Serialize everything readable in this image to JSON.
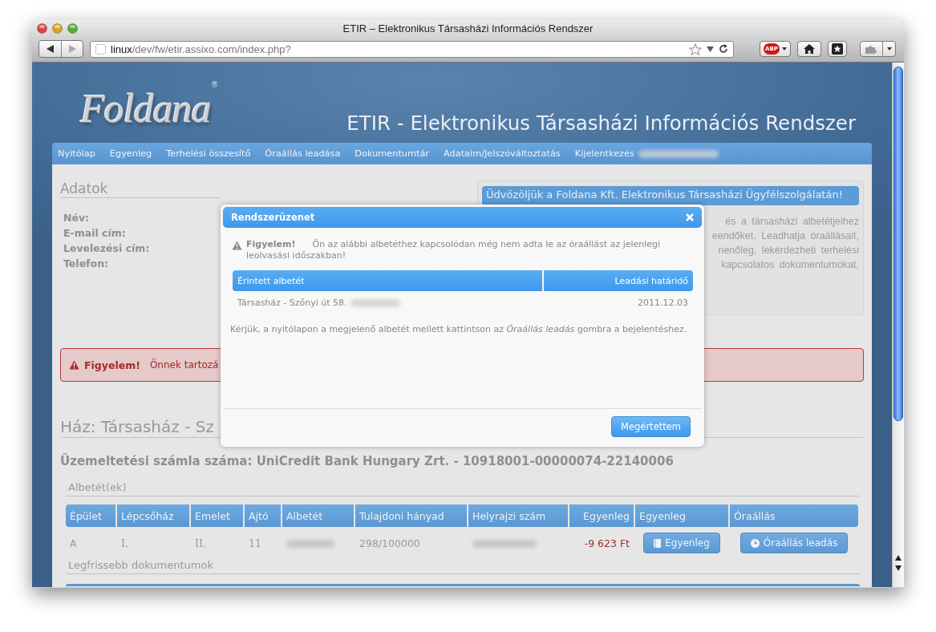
{
  "window": {
    "title": "ETIR – Elektronikus Társasházi Információs Rendszer"
  },
  "toolbar": {
    "url_host": "linux",
    "url_path": "/dev/fw/etir.assixo.com/index.php?",
    "adblock_label": "ABP"
  },
  "header": {
    "logo": "Foldana",
    "logo_mark": "®",
    "title": "ETIR - Elektronikus Társasházi Információs Rendszer"
  },
  "nav": [
    {
      "label": "Nyitólap"
    },
    {
      "label": "Egyenleg"
    },
    {
      "label": "Terhelési összesítő"
    },
    {
      "label": "Óraállás leadása"
    },
    {
      "label": "Dokumentumtár"
    },
    {
      "label": "Adataim/Jelszóváltoztatás"
    },
    {
      "label": "Kijelentkezés"
    }
  ],
  "details": {
    "title": "Adatok",
    "fields": [
      "Név:",
      "E-mail cím:",
      "Levelezési cím:",
      "Telefon:"
    ]
  },
  "welcome": {
    "title": "Üdvözöljük a Foldana Kft. Elektronikus Társasházi Ügyfélszolgálatán!",
    "lines": [
      "és a társasházi albetétjeihez",
      "eendőket. Leadhatja óraállásait,",
      "nenőleg, lekérdezheti terhelési",
      "kapcsolatos dokumentumokat,"
    ]
  },
  "alert": {
    "label": "Figyelem!",
    "text": "Önnek tartozá"
  },
  "house": {
    "title": "Ház: Társasház - Sz",
    "account": "Üzemeltetési számla száma: UniCredit Bank Hungary Zrt. - 10918001-00000074-22140006"
  },
  "units": {
    "title": "Albetét(ek)",
    "columns": [
      "Épület",
      "Lépcsőház",
      "Emelet",
      "Ajtó",
      "Albetét",
      "Tulajdoni hányad",
      "Helyrajzi szám",
      "Egyenleg",
      "Egyenleg",
      "Óraállás"
    ],
    "rows": [
      {
        "building": "A",
        "staircase": "I.",
        "floor": "II.",
        "door": "11",
        "share": "298/100000",
        "balance": "-9 623 Ft",
        "balance_button": "Egyenleg",
        "reading_button": "Óraállás leadás"
      }
    ]
  },
  "documents": {
    "title": "Legfrissebb dokumentumok"
  },
  "modal": {
    "title": "Rendszerüzenet",
    "warning": "**Figyelem!**      Ön az alábbi albetéthez kapcsolódan még nem adta le az óraállást az jelenlegi leolvasási időszakban!",
    "columns": [
      "Érintett albetét",
      "Leadási határidő"
    ],
    "rows": [
      {
        "unit": "Társasház - Szőnyi út 58.",
        "deadline": "2011.12.03"
      }
    ],
    "instruction": "Kérjük, a nyitólapon a megjelenő albetét mellett kattintson az *Óraállás leadás* gombra a bejelentéshez.",
    "button": "Megértettem"
  }
}
